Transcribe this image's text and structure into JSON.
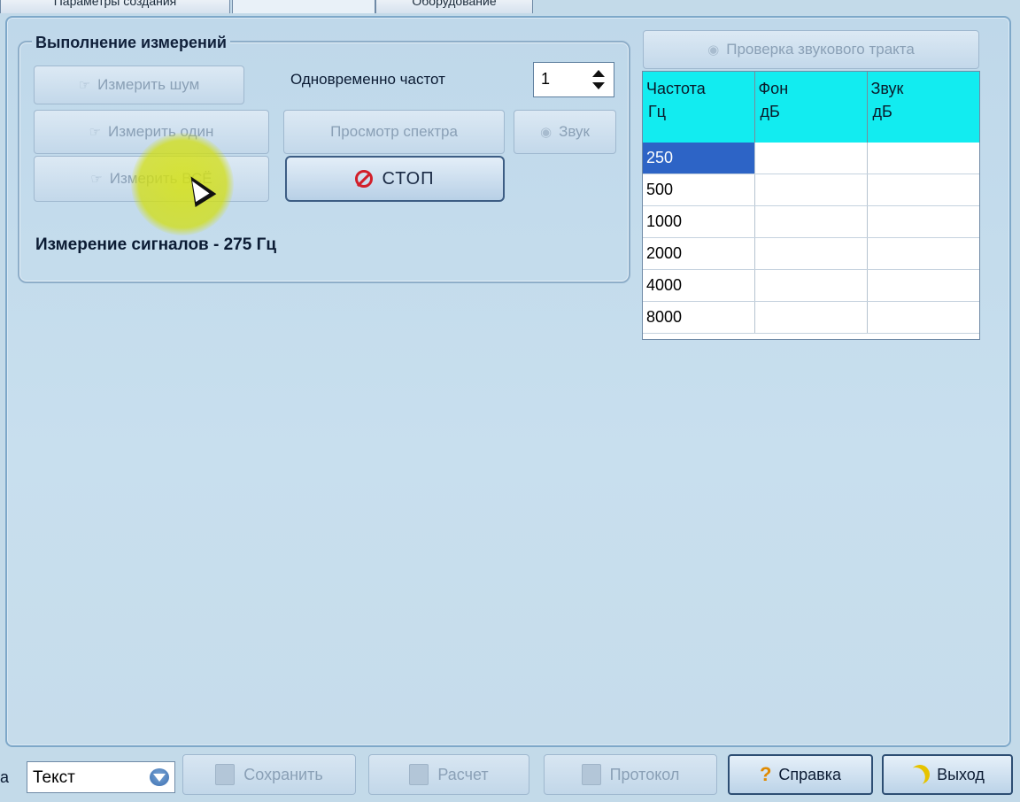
{
  "tabs": [
    {
      "label": "Параметры создания"
    },
    {
      "label": ""
    },
    {
      "label": "Оборудование"
    }
  ],
  "measurement_group": {
    "title": "Выполнение измерений",
    "buttons": {
      "measure_noise": "Измерить шум",
      "measure_one": "Измерить один",
      "measure_all": "Измерить ВСЁ",
      "view_spectrum": "Просмотр спектра",
      "sound": "Звук",
      "stop": "СТОП"
    },
    "simultaneous_label": "Одновременно частот",
    "simultaneous_value": "1",
    "status": "Измерение сигналов - 275 Гц"
  },
  "check_sound_path_button": "Проверка звукового тракта",
  "table": {
    "headers": [
      {
        "line1": "Частота",
        "line2": "Гц"
      },
      {
        "line1": "Фон",
        "line2": "дБ"
      },
      {
        "line1": "Звук",
        "line2": "дБ"
      }
    ],
    "rows": [
      {
        "freq": "250",
        "bg": "",
        "snd": ""
      },
      {
        "freq": "500",
        "bg": "",
        "snd": ""
      },
      {
        "freq": "1000",
        "bg": "",
        "snd": ""
      },
      {
        "freq": "2000",
        "bg": "",
        "snd": ""
      },
      {
        "freq": "4000",
        "bg": "",
        "snd": ""
      },
      {
        "freq": "8000",
        "bg": "",
        "snd": ""
      }
    ],
    "selected_row": 0,
    "header_color": "#12ecf0",
    "selection_color": "#2d64c6"
  },
  "bottom_toolbar": {
    "leading_text": "а",
    "format_select": "Текст",
    "save": "Сохранить",
    "calc": "Расчет",
    "protocol": "Протокол",
    "help": "Справка",
    "exit": "Выход"
  },
  "icons": {
    "measure": "hand-pointer-icon",
    "stop": "stop-sign-icon",
    "sound": "speaker-icon",
    "help": "question-icon",
    "exit": "moon-exit-icon"
  }
}
